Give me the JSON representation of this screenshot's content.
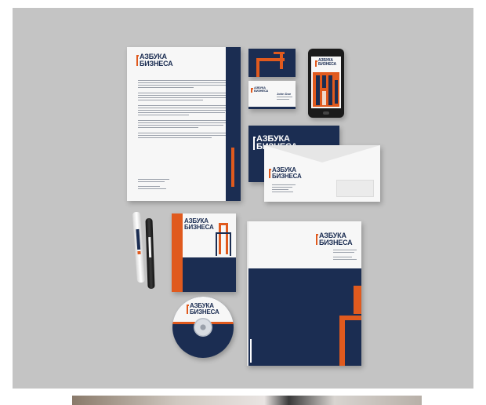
{
  "brand": {
    "line1": "АЗБУКА",
    "line2": "БИЗНЕСА",
    "card_name": "John Doe"
  },
  "colors": {
    "navy": "#1b2d52",
    "orange": "#e05a1e",
    "paper": "#f7f7f7",
    "background": "#c4c4c4"
  }
}
